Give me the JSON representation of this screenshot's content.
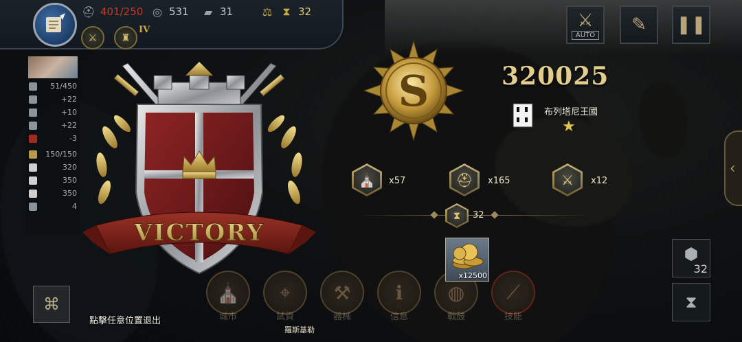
{
  "topbar": {
    "troops": "401/250",
    "gold": "531",
    "iron": "31",
    "turns": "32",
    "tier": "IV",
    "icons": [
      "helmet-icon",
      "coin-icon",
      "iron-bar-icon",
      "scales-icon",
      "hourglass-icon"
    ]
  },
  "top_buttons": {
    "auto_label": "AUTO"
  },
  "province_panel": {
    "stats": [
      {
        "icon": "castle-icon",
        "value": "51/450"
      },
      {
        "icon": "coin-icon",
        "value": "+22"
      },
      {
        "icon": "grain-icon",
        "value": "+10"
      },
      {
        "icon": "helmet-icon",
        "value": "+22"
      },
      {
        "icon": "boot-icon",
        "value": "-3"
      }
    ],
    "army": [
      {
        "icon": "eagle-icon",
        "value": "150/150"
      },
      {
        "icon": "horse-icon",
        "value": "320"
      },
      {
        "icon": "horse-icon",
        "value": "350"
      },
      {
        "icon": "horse-icon",
        "value": "350"
      },
      {
        "icon": "boot-icon",
        "value": "4"
      }
    ]
  },
  "victory": {
    "banner": "VICTORY",
    "score": "320025",
    "kingdom_name": "布列塔尼王國",
    "rewards": [
      {
        "icon": "cathedral-icon",
        "count": "x57"
      },
      {
        "icon": "helmet-icon",
        "count": "x165"
      },
      {
        "icon": "crossed-swords-icon",
        "count": "x12"
      }
    ],
    "turns_icon": "hourglass-icon",
    "turns": "32",
    "item_reward": {
      "icon": "gold-coins-icon",
      "amount": "x12500"
    }
  },
  "bottom_menu": [
    {
      "name": "city",
      "label": "城市",
      "icon": "cathedral-icon"
    },
    {
      "name": "diplomacy",
      "label": "試資",
      "icon": "map-pin-icon"
    },
    {
      "name": "siege",
      "label": "器械",
      "icon": "catapult-icon"
    },
    {
      "name": "info",
      "label": "信息",
      "icon": "info-icon"
    },
    {
      "name": "battle",
      "label": "戰鼓",
      "icon": "drum-icon"
    },
    {
      "name": "skill",
      "label": "技能",
      "icon": "lance-icon"
    }
  ],
  "exit_hint": "點擊任意位置退出",
  "map_label": "羅斯基勒",
  "right_panel": {
    "hex_count": "32"
  },
  "colors": {
    "gold": "#e2cd8c",
    "troop_red": "#c0392b",
    "shield_red": "#7a1d1d"
  }
}
